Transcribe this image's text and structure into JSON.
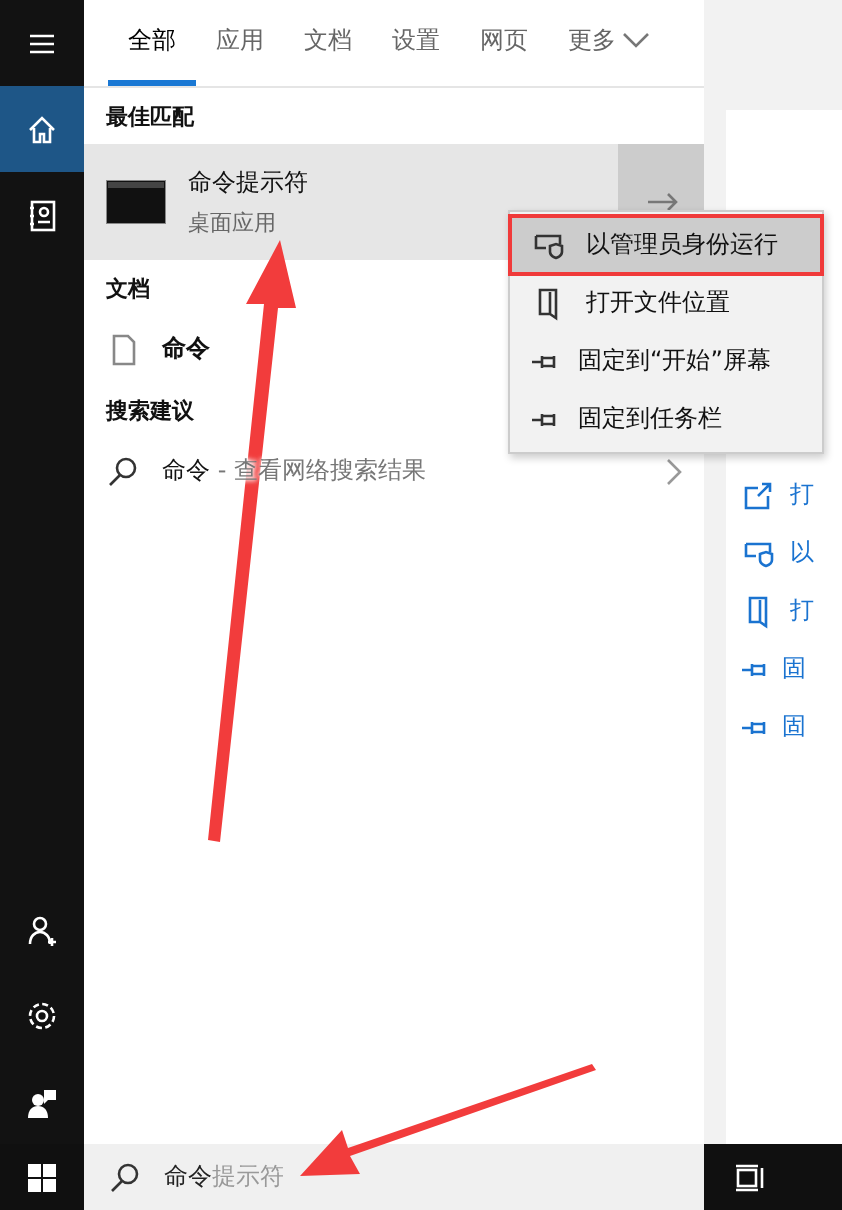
{
  "sidebar": {
    "top": [
      {
        "kind": "menu",
        "selected": false
      },
      {
        "kind": "home",
        "selected": true
      },
      {
        "kind": "notebook",
        "selected": false
      }
    ],
    "bottom": [
      {
        "kind": "person",
        "selected": false
      },
      {
        "kind": "settings",
        "selected": false
      },
      {
        "kind": "feedback",
        "selected": false
      }
    ]
  },
  "tabs": [
    {
      "label": "全部",
      "selected": true
    },
    {
      "label": "应用",
      "selected": false
    },
    {
      "label": "文档",
      "selected": false
    },
    {
      "label": "设置",
      "selected": false
    },
    {
      "label": "网页",
      "selected": false
    },
    {
      "label": "更多",
      "selected": false,
      "dropdown": true
    }
  ],
  "best_match": {
    "title": "最佳匹配",
    "name": "命令提示符",
    "subtitle": "桌面应用",
    "selected": true
  },
  "documents": {
    "title": "文档",
    "items": [
      {
        "name": "命令"
      }
    ]
  },
  "suggestions": {
    "title": "搜索建议",
    "items": [
      {
        "query": "命令",
        "hint": " - 查看网络搜索结果"
      }
    ]
  },
  "context_menu": [
    {
      "kind": "shield",
      "label": "以管理员身份运行",
      "selected": true
    },
    {
      "kind": "folder",
      "label": "打开文件位置",
      "selected": false
    },
    {
      "kind": "pin",
      "label": "固定到“开始”屏幕",
      "selected": false
    },
    {
      "kind": "pin",
      "label": "固定到任务栏",
      "selected": false
    }
  ],
  "detail_actions": [
    {
      "kind": "open",
      "label": "打"
    },
    {
      "kind": "shield",
      "label": "以"
    },
    {
      "kind": "folder",
      "label": "打"
    },
    {
      "kind": "pin",
      "label": "固"
    },
    {
      "kind": "pin",
      "label": "固"
    }
  ],
  "search_box": {
    "value": "命令",
    "completion": "提示符"
  }
}
